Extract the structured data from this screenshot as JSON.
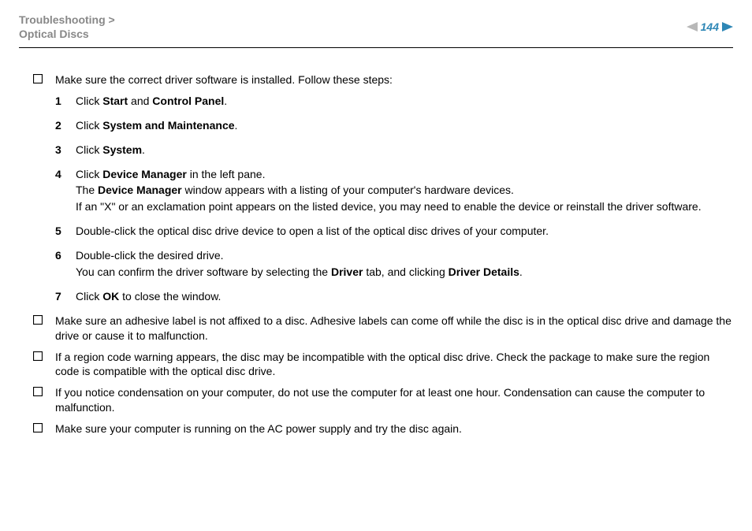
{
  "breadcrumb": {
    "line1": "Troubleshooting >",
    "line2": "Optical Discs"
  },
  "page_number": "144",
  "intro_bullet": "Make sure the correct driver software is installed. Follow these steps:",
  "steps": [
    {
      "num": "1",
      "parts": [
        {
          "t": "Click "
        },
        {
          "t": "Start",
          "b": true
        },
        {
          "t": " and "
        },
        {
          "t": "Control Panel",
          "b": true
        },
        {
          "t": "."
        }
      ]
    },
    {
      "num": "2",
      "parts": [
        {
          "t": "Click "
        },
        {
          "t": "System and Maintenance",
          "b": true
        },
        {
          "t": "."
        }
      ]
    },
    {
      "num": "3",
      "parts": [
        {
          "t": "Click "
        },
        {
          "t": "System",
          "b": true
        },
        {
          "t": "."
        }
      ]
    },
    {
      "num": "4",
      "lines": [
        [
          {
            "t": "Click "
          },
          {
            "t": "Device Manager",
            "b": true
          },
          {
            "t": " in the left pane."
          }
        ],
        [
          {
            "t": "The "
          },
          {
            "t": "Device Manager",
            "b": true
          },
          {
            "t": " window appears with a listing of your computer's hardware devices."
          }
        ],
        [
          {
            "t": "If an \"X\" or an exclamation point appears on the listed device, you may need to enable the device or reinstall the driver software."
          }
        ]
      ]
    },
    {
      "num": "5",
      "parts": [
        {
          "t": "Double-click the optical disc drive device to open a list of the optical disc drives of your computer."
        }
      ]
    },
    {
      "num": "6",
      "lines": [
        [
          {
            "t": "Double-click the desired drive."
          }
        ],
        [
          {
            "t": "You can confirm the driver software by selecting the "
          },
          {
            "t": "Driver",
            "b": true
          },
          {
            "t": " tab, and clicking "
          },
          {
            "t": "Driver Details",
            "b": true
          },
          {
            "t": "."
          }
        ]
      ]
    },
    {
      "num": "7",
      "parts": [
        {
          "t": "Click "
        },
        {
          "t": "OK",
          "b": true
        },
        {
          "t": " to close the window."
        }
      ]
    }
  ],
  "bullets": [
    "Make sure an adhesive label is not affixed to a disc. Adhesive labels can come off while the disc is in the optical disc drive and damage the drive or cause it to malfunction.",
    "If a region code warning appears, the disc may be incompatible with the optical disc drive. Check the package to make sure the region code is compatible with the optical disc drive.",
    "If you notice condensation on your computer, do not use the computer for at least one hour. Condensation can cause the computer to malfunction.",
    "Make sure your computer is running on the AC power supply and try the disc again."
  ]
}
